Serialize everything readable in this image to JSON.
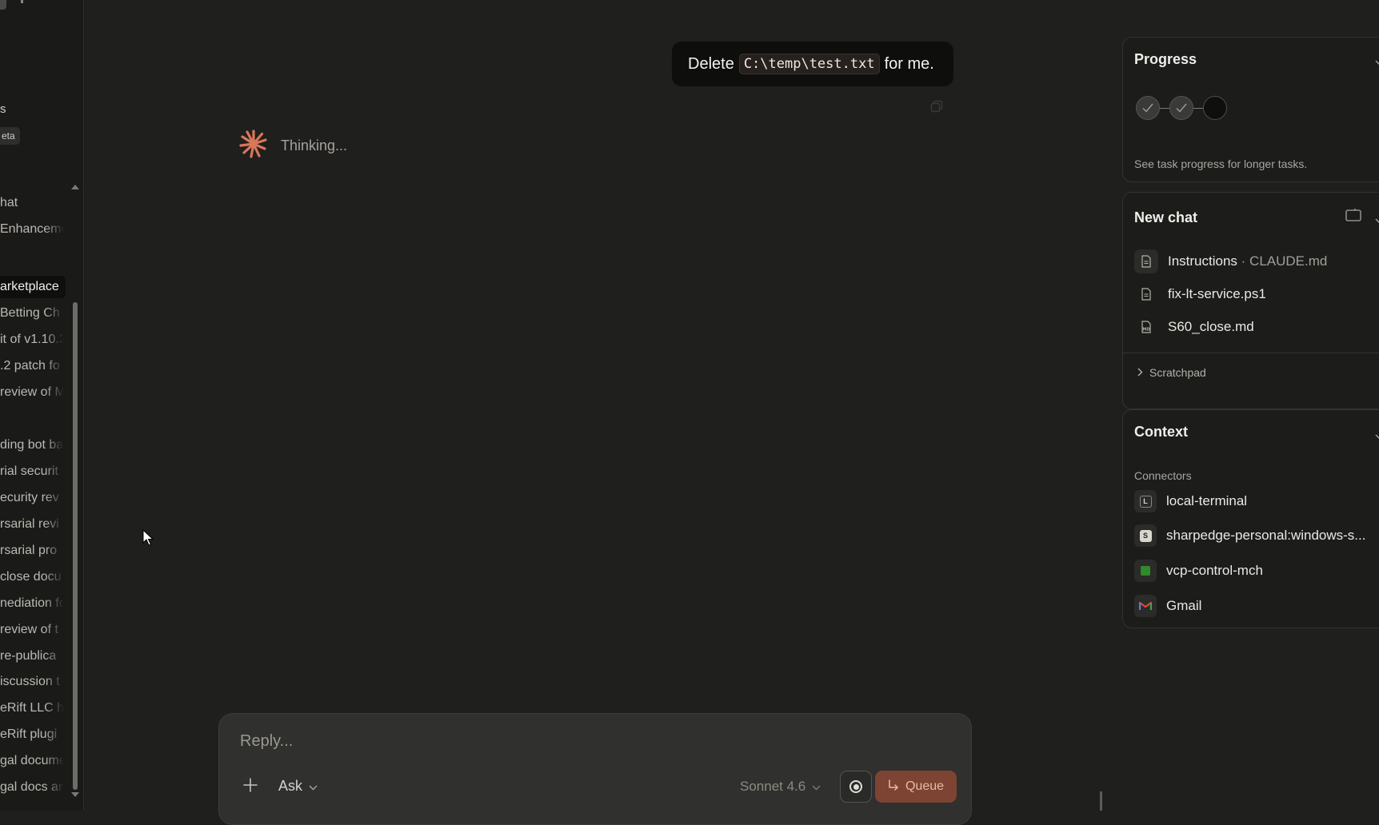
{
  "sidebar": {
    "fragments": [
      "s",
      "eta"
    ],
    "items": [
      {
        "label": "hat"
      },
      {
        "label": "Enhanceme"
      },
      {
        "label": "arketplace",
        "active": true
      },
      {
        "label": "Betting Ch"
      },
      {
        "label": "it of v1.10.3"
      },
      {
        "label": ".2 patch fo"
      },
      {
        "label": "review of M"
      },
      {
        "label": "ding bot ba"
      },
      {
        "label": "rial securit"
      },
      {
        "label": "ecurity rev"
      },
      {
        "label": "rsarial revi"
      },
      {
        "label": "rsarial pro"
      },
      {
        "label": "close docu"
      },
      {
        "label": "nediation fo"
      },
      {
        "label": "review of t"
      },
      {
        "label": "re-publica"
      },
      {
        "label": "iscussion t"
      },
      {
        "label": "eRift LLC h"
      },
      {
        "label": "eRift plugi"
      },
      {
        "label": "gal docume"
      },
      {
        "label": "gal docs an"
      }
    ]
  },
  "chat": {
    "user_message": {
      "before": "Delete",
      "code": "C:\\temp\\test.txt",
      "after": "for me."
    },
    "status": "Thinking..."
  },
  "composer": {
    "placeholder": "Reply...",
    "mode_label": "Ask",
    "model_label": "Sonnet 4.6",
    "queue_label": "Queue"
  },
  "progress_panel": {
    "title": "Progress",
    "steps": [
      "done",
      "done",
      "pending"
    ],
    "note": "See task progress for longer tasks."
  },
  "new_chat_panel": {
    "title": "New chat",
    "files": [
      {
        "name": "Instructions",
        "sub": "· CLAUDE.md",
        "icon": "document-icon"
      },
      {
        "name": "fix-lt-service.ps1",
        "sub": "",
        "icon": "document-icon"
      },
      {
        "name": "S60_close.md",
        "sub": "",
        "icon": "markdown-file-icon"
      }
    ],
    "scratchpad_label": "Scratchpad"
  },
  "context_panel": {
    "title": "Context",
    "section_label": "Connectors",
    "connectors": [
      {
        "name": "local-terminal",
        "letter": "L"
      },
      {
        "name": "sharpedge-personal:windows-s...",
        "letter": "S"
      },
      {
        "name": "vcp-control-mch",
        "letter": ""
      },
      {
        "name": "Gmail",
        "letter": "M"
      }
    ]
  },
  "colors": {
    "accent_star": "#d97757",
    "queue_button": "#7d4433",
    "connector_green": "#2f8a2a",
    "gmail_red": "#ea4335"
  }
}
